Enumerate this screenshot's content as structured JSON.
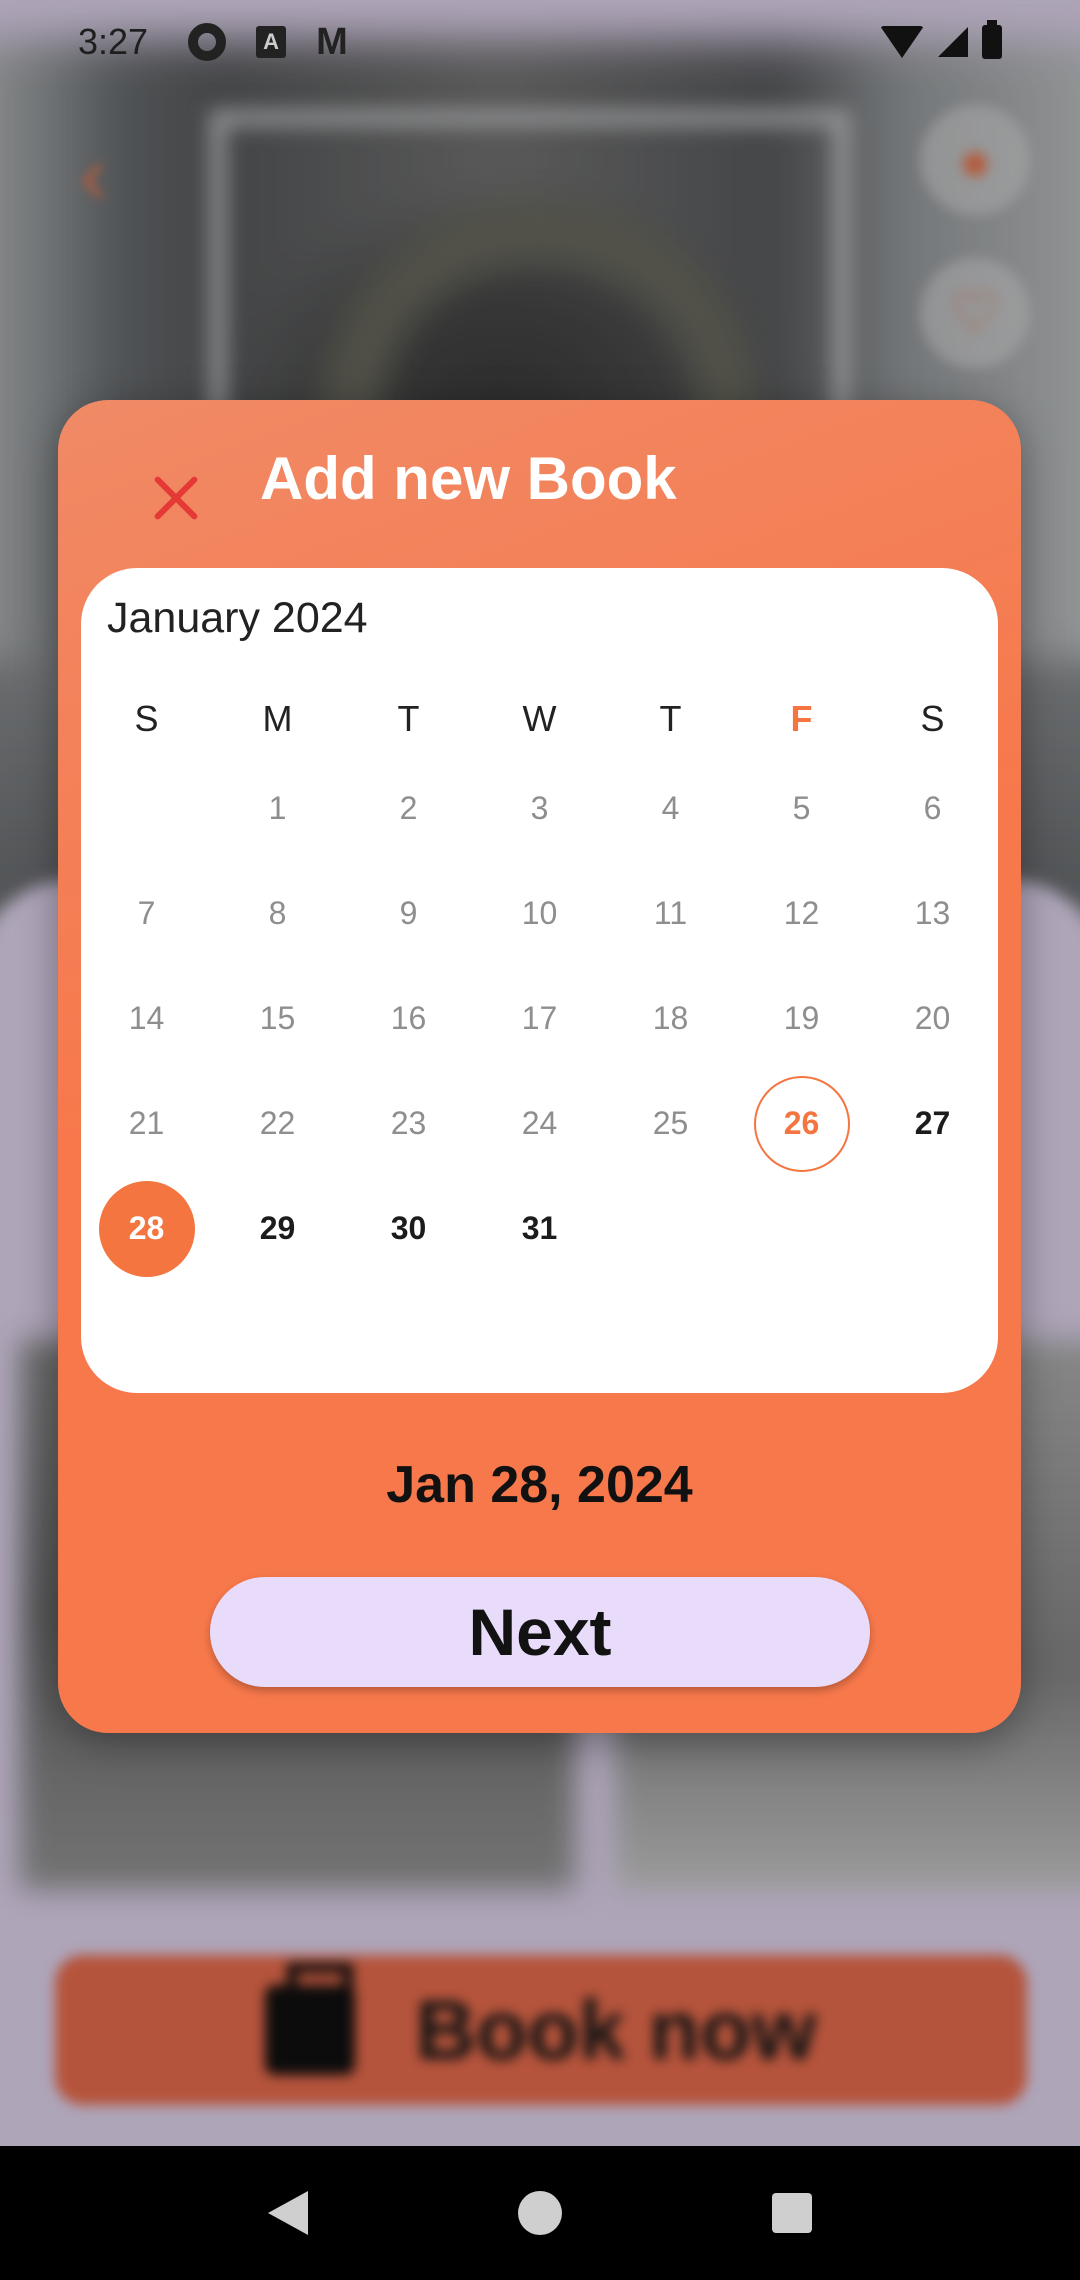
{
  "status_bar": {
    "time": "3:27",
    "icons": [
      "gear-icon",
      "a-icon",
      "gmail-icon",
      "wifi-icon",
      "signal-icon",
      "battery-icon"
    ]
  },
  "background": {
    "book_now_label": "Book now"
  },
  "dialog": {
    "title": "Add new Book",
    "calendar": {
      "month": "January 2024",
      "weekdays": [
        "S",
        "M",
        "T",
        "W",
        "T",
        "F",
        "S"
      ],
      "highlighted_weekday_index": 5,
      "weeks": [
        [
          "",
          "1",
          "2",
          "3",
          "4",
          "5",
          "6"
        ],
        [
          "7",
          "8",
          "9",
          "10",
          "11",
          "12",
          "13"
        ],
        [
          "14",
          "15",
          "16",
          "17",
          "18",
          "19",
          "20"
        ],
        [
          "21",
          "22",
          "23",
          "24",
          "25",
          "26",
          "27"
        ],
        [
          "28",
          "29",
          "30",
          "31",
          "",
          "",
          ""
        ]
      ],
      "today": "26",
      "selected": "28",
      "enabled_from": 27
    },
    "selected_date_label": "Jan 28, 2024",
    "next_label": "Next"
  },
  "colors": {
    "accent": "#f4753f",
    "next_button": "#e9dcfb",
    "close_icon": "#e53935"
  }
}
